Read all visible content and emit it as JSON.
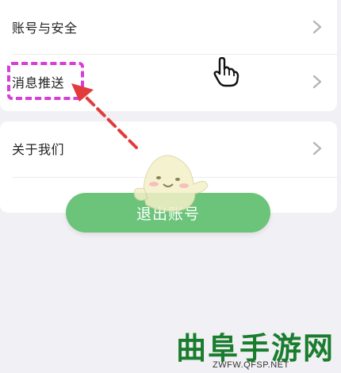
{
  "settings": {
    "account_security": "账号与安全",
    "message_push": "消息推送",
    "about_us": "关于我们"
  },
  "logout_button": "退出账号",
  "watermark": {
    "title": "曲阜手游网",
    "url": "ZWFW.QFSP.NET"
  },
  "colors": {
    "accent_green": "#6cc37a",
    "highlight_magenta": "#d63fd6",
    "arrow_red": "#e23b3b",
    "watermark_green": "#1a7d2d"
  },
  "icons": [
    "chevron-right-icon",
    "hand-pointer-icon",
    "mascot-icon",
    "red-arrow-icon"
  ]
}
